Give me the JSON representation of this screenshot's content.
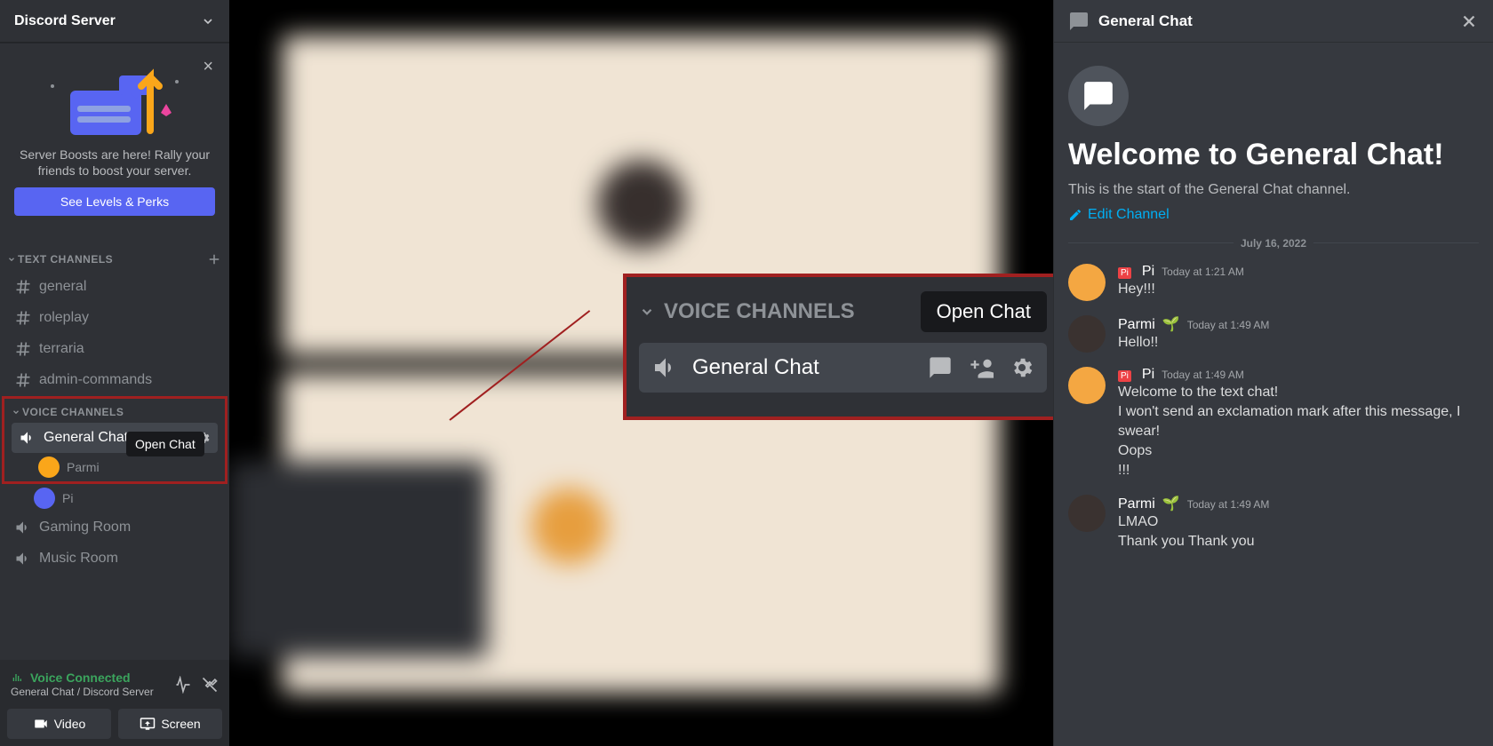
{
  "server": {
    "name": "Discord Server"
  },
  "boost": {
    "text": "Server Boosts are here! Rally your friends to boost your server.",
    "button": "See Levels & Perks"
  },
  "categories": {
    "text": "TEXT CHANNELS",
    "voice": "VOICE CHANNELS"
  },
  "textChannels": [
    {
      "name": "general"
    },
    {
      "name": "roleplay"
    },
    {
      "name": "terraria"
    },
    {
      "name": "admin-commands"
    }
  ],
  "voiceChannels": [
    {
      "name": "General Chat",
      "active": true
    },
    {
      "name": "Gaming Room"
    },
    {
      "name": "Music Room"
    }
  ],
  "voiceUsers": [
    {
      "name": "Parmi"
    },
    {
      "name": "Pi"
    }
  ],
  "tooltip": {
    "openChat": "Open Chat"
  },
  "zoom": {
    "cat": "VOICE CHANNELS",
    "channel": "General Chat",
    "tooltip": "Open Chat"
  },
  "voiceStatus": {
    "connected": "Voice Connected",
    "location": "General Chat / Discord Server"
  },
  "bottomButtons": {
    "video": "Video",
    "screen": "Screen"
  },
  "chat": {
    "title": "General Chat",
    "welcomeTitle": "Welcome to General Chat!",
    "welcomeSub": "This is the start of the General Chat channel.",
    "editChannel": "Edit Channel",
    "date": "July 16, 2022"
  },
  "messages": [
    {
      "author": "Pi",
      "time": "Today at 1:21 AM",
      "lines": [
        "Hey!!!"
      ],
      "piIcon": true,
      "avatarColor": "#f4a742"
    },
    {
      "author": "Parmi",
      "time": "Today at 1:49 AM",
      "lines": [
        "Hello!!"
      ],
      "leaf": true,
      "avatarColor": "#3a3230"
    },
    {
      "author": "Pi",
      "time": "Today at 1:49 AM",
      "lines": [
        "Welcome to the text chat!",
        "I won't send an exclamation mark after this message, I swear!",
        "Oops",
        "!!!"
      ],
      "piIcon": true,
      "avatarColor": "#f4a742"
    },
    {
      "author": "Parmi",
      "time": "Today at 1:49 AM",
      "lines": [
        "LMAO",
        "Thank you Thank you"
      ],
      "leaf": true,
      "avatarColor": "#3a3230"
    }
  ]
}
